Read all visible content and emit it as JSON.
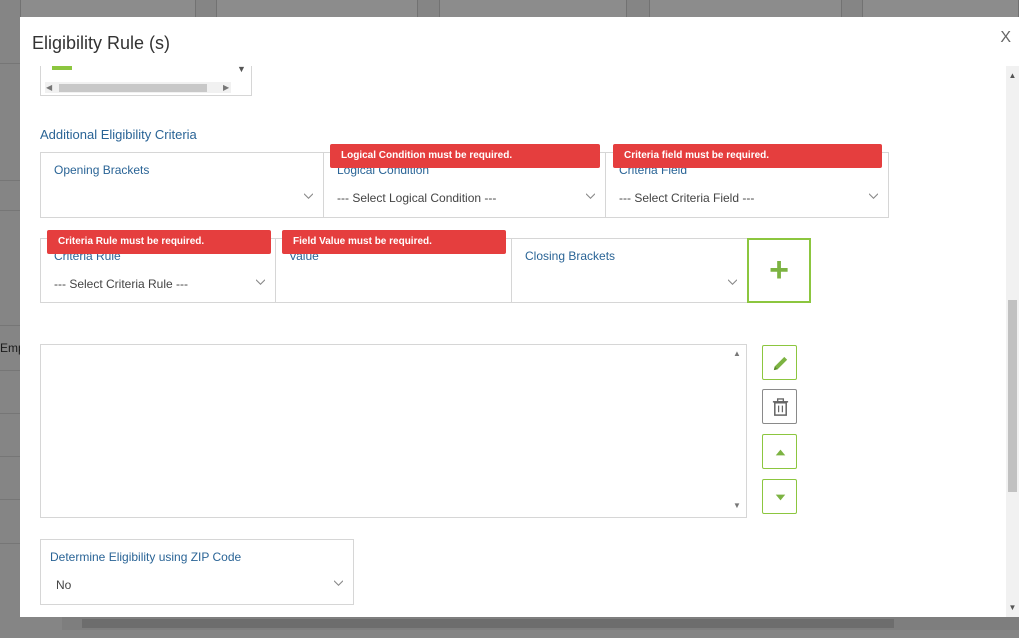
{
  "background": {
    "partial_text": "Emp"
  },
  "modal": {
    "title": "Eligibility Rule (s)",
    "close_label": "X"
  },
  "section": {
    "title": "Additional Eligibility Criteria"
  },
  "fields": {
    "opening_brackets": {
      "label": "Opening Brackets",
      "value": ""
    },
    "logical_condition": {
      "label": "Logical Condition",
      "value": "--- Select Logical Condition ---",
      "error": "Logical Condition must be required."
    },
    "criteria_field": {
      "label": "Criteria Field",
      "value": "--- Select Criteria Field ---",
      "error": "Criteria field must be required."
    },
    "criteria_rule": {
      "label": "Criteria Rule",
      "value": "--- Select Criteria Rule ---",
      "error": "Criteria Rule must be required."
    },
    "value": {
      "label": "Value",
      "value": "",
      "error": "Field Value must be required."
    },
    "closing_brackets": {
      "label": "Closing Brackets",
      "value": ""
    },
    "zip_code": {
      "label": "Determine Eligibility using ZIP Code",
      "value": "No"
    }
  },
  "buttons": {
    "add_icon": "plus-icon",
    "edit_icon": "pencil-icon",
    "delete_icon": "trash-icon",
    "move_up_icon": "triangle-up-icon",
    "move_down_icon": "triangle-down-icon"
  },
  "colors": {
    "accent_green": "#8cc63f",
    "label_blue": "#2a6496",
    "error_red": "#e53e3e"
  }
}
